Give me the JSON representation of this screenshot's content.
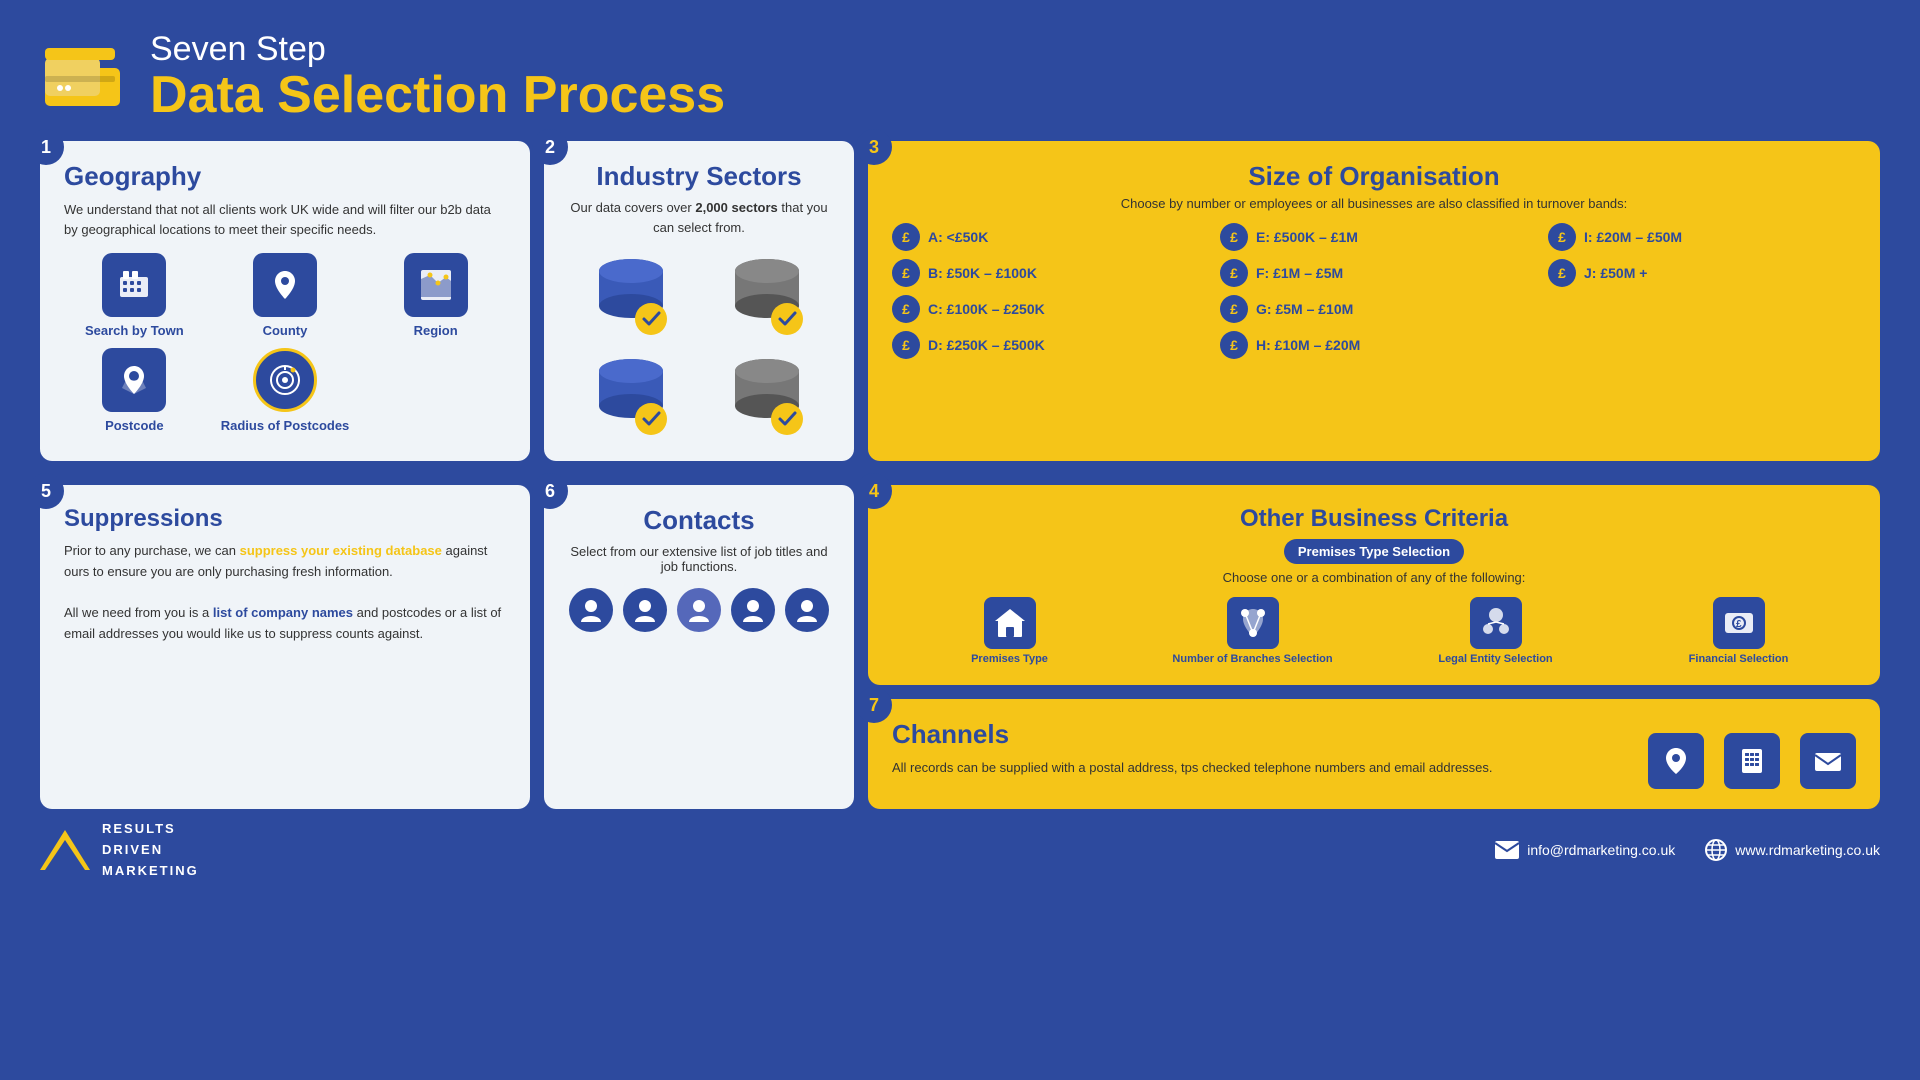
{
  "header": {
    "subtitle": "Seven Step",
    "title": "Data Selection Process"
  },
  "step1": {
    "number": "1",
    "title": "Geography",
    "body": "We understand that not all clients work UK wide and will filter our b2b data by geographical locations to meet their specific needs.",
    "icons": [
      {
        "label": "Search by Town",
        "name": "search-by-town"
      },
      {
        "label": "County",
        "name": "county"
      },
      {
        "label": "Region",
        "name": "region"
      },
      {
        "label": "Postcode",
        "name": "postcode"
      },
      {
        "label": "Radius of Postcodes",
        "name": "radius-of-postcodes"
      }
    ]
  },
  "step2": {
    "number": "2",
    "title": "Industry Sectors",
    "body": "Our data covers over ",
    "bold": "2,000 sectors",
    "body2": " that you can select from."
  },
  "step3": {
    "number": "3",
    "title": "Size of Organisation",
    "subtitle": "Choose by number or employees or all businesses are also classified in turnover bands:",
    "bands": [
      {
        "label": "A: <£50K"
      },
      {
        "label": "E: £500K – £1M"
      },
      {
        "label": "I: £20M – £50M"
      },
      {
        "label": "B: £50K – £100K"
      },
      {
        "label": "F: £1M – £5M"
      },
      {
        "label": "J: £50M +"
      },
      {
        "label": "C: £100K – £250K"
      },
      {
        "label": "G: £5M – £10M"
      },
      {
        "label": ""
      },
      {
        "label": "D: £250K – £500K"
      },
      {
        "label": "H: £10M – £20M"
      },
      {
        "label": ""
      }
    ]
  },
  "step4": {
    "number": "4",
    "title": "Other Business Criteria",
    "badge": "Premises Type Selection",
    "subtitle": "Choose one or a combination of any of the following:",
    "icons": [
      {
        "label": "Premises Type"
      },
      {
        "label": "Number of Branches Selection"
      },
      {
        "label": "Legal Entity Selection"
      },
      {
        "label": "Financial Selection"
      }
    ]
  },
  "step5": {
    "number": "5",
    "title": "Suppressions",
    "body1": "Prior to any purchase, we can ",
    "link1": "suppress your existing database",
    "body2": " against ours to ensure you are only purchasing fresh information.",
    "body3": "\n\nAll we need from you is a ",
    "link2": "list of company names",
    "body4": " and postcodes or a list of email addresses you would like us to suppress counts against."
  },
  "step6": {
    "number": "6",
    "title": "Contacts",
    "body": "Select from our extensive list of job titles and job functions."
  },
  "step7": {
    "number": "7",
    "title": "Channels",
    "body": "All records can be supplied with a postal address, tps checked telephone numbers and email addresses."
  },
  "footer": {
    "logo_lines": [
      "RESULTS",
      "DRIVEN",
      "MARKETING"
    ],
    "email": "info@rdmarketing.co.uk",
    "website": "www.rdmarketing.co.uk"
  }
}
